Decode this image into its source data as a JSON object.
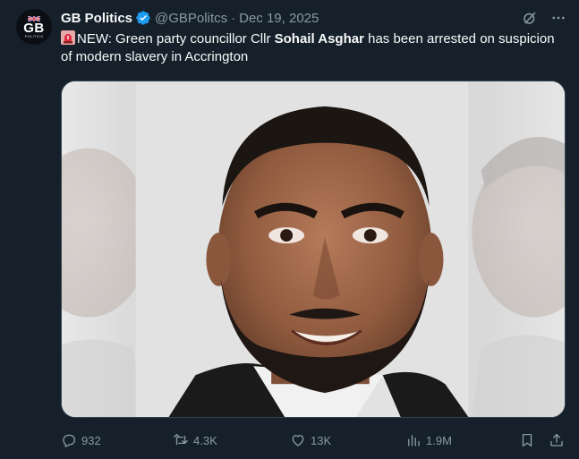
{
  "author": {
    "avatar_text": "GB",
    "avatar_subtext": "POLITICS",
    "name": "GB Politics",
    "handle": "@GBPolitcs",
    "date": "Dec 19, 2025"
  },
  "tweet": {
    "text_before": "NEW: Green party councillor Cllr ",
    "text_bold": "Sohail Asghar",
    "text_after": " has been arrested on suspicion of modern slavery in Accrington"
  },
  "metrics": {
    "replies": "932",
    "reposts": "4.3K",
    "likes": "13K",
    "views": "1.9M"
  },
  "icons": {
    "verified": "verified-badge-icon",
    "grok": "grok-icon",
    "more": "more-icon",
    "siren": "siren-emoji-icon",
    "reply": "reply-icon",
    "repost": "repost-icon",
    "like": "heart-icon",
    "views": "views-icon",
    "bookmark": "bookmark-icon",
    "share": "share-icon"
  },
  "colors": {
    "background": "#15202b",
    "text": "#f7f9f9",
    "muted": "#8b98a5",
    "verified": "#1d9bf0",
    "border": "#38444d"
  }
}
